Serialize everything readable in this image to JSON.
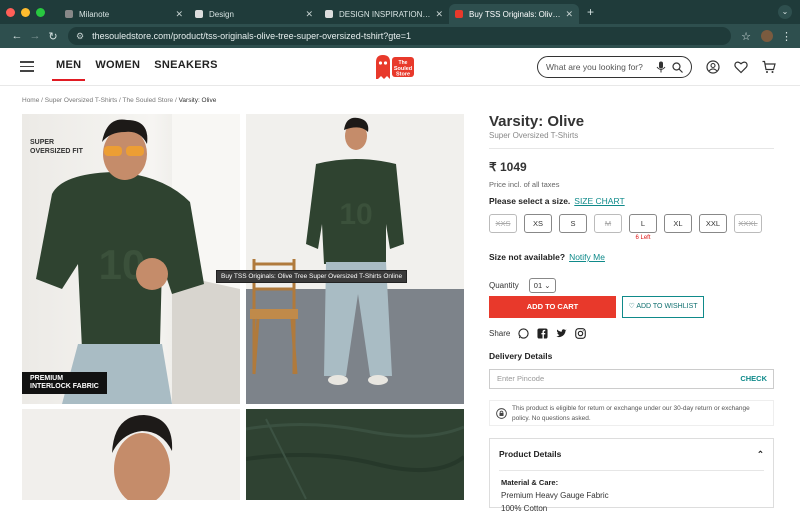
{
  "browser": {
    "tabs": [
      {
        "label": "Milanote",
        "active": false
      },
      {
        "label": "Design",
        "active": false
      },
      {
        "label": "DESIGN INSPIRATION | Playb",
        "active": false
      },
      {
        "label": "Buy TSS Originals: Olive Tree",
        "active": true
      }
    ],
    "url": "thesouledstore.com/product/tss-originals-olive-tree-super-oversized-tshirt?gte=1"
  },
  "header": {
    "nav": [
      "MEN",
      "WOMEN",
      "SNEAKERS"
    ],
    "logo_text": "The Souled Store",
    "search_placeholder": "What are you looking for?"
  },
  "breadcrumb": {
    "links": "Home / Super Oversized T-Shirts / The Souled Store / ",
    "current": "Varsity: Olive"
  },
  "gallery": {
    "badge_top": "SUPER\nOVERSIZED FIT",
    "badge_bottom": "PREMIUM\nINTERLOCK FABRIC",
    "tooltip": "Buy TSS Originals: Olive Tree Super Oversized T-Shirts Online",
    "jersey_number": "10"
  },
  "product": {
    "title": "Varsity: Olive",
    "subtitle": "Super Oversized T-Shirts",
    "price": "₹ 1049",
    "price_note": "Price incl. of all taxes",
    "size_prompt": "Please select a size.",
    "size_chart": "SIZE CHART",
    "sizes": [
      {
        "label": "XXS",
        "available": false,
        "note": ""
      },
      {
        "label": "XS",
        "available": true,
        "note": ""
      },
      {
        "label": "S",
        "available": true,
        "note": ""
      },
      {
        "label": "M",
        "available": false,
        "note": ""
      },
      {
        "label": "L",
        "available": true,
        "note": "6 Left"
      },
      {
        "label": "XL",
        "available": true,
        "note": ""
      },
      {
        "label": "XXL",
        "available": true,
        "note": ""
      },
      {
        "label": "XXXL",
        "available": false,
        "note": ""
      }
    ],
    "size_not_available": "Size not available?",
    "notify_me": "Notify Me",
    "quantity_label": "Quantity",
    "quantity_value": "01",
    "add_to_cart": "ADD TO CART",
    "add_to_wishlist": "ADD TO WISHLIST",
    "share_label": "Share",
    "delivery_label": "Delivery Details",
    "pincode_placeholder": "Enter Pincode",
    "check_label": "CHECK",
    "return_text": "This product is eligible for return or exchange under our 30-day return or exchange policy. No questions asked.",
    "details_title": "Product Details",
    "material_label": "Material & Care:",
    "material_value": "Premium Heavy Gauge Fabric",
    "material_value_2": "100% Cotton"
  },
  "colors": {
    "brand_red": "#e8392b",
    "teal": "#0f8a8a",
    "olive": "#3a4a3a"
  }
}
